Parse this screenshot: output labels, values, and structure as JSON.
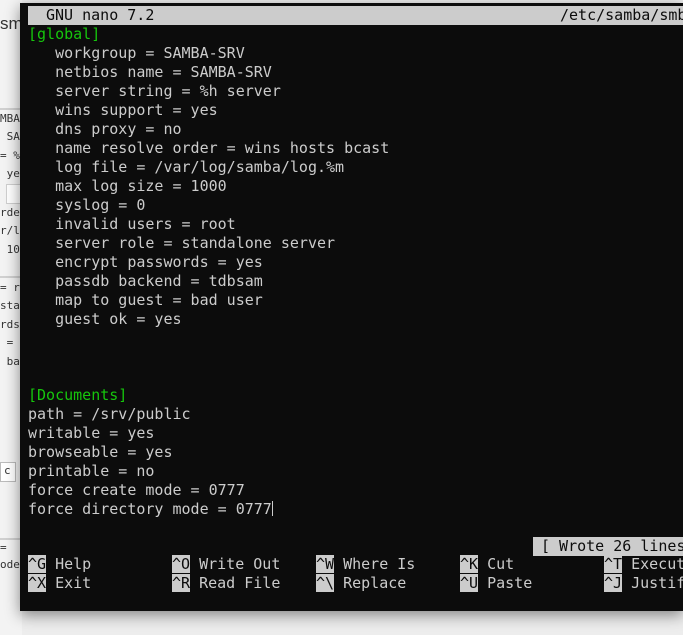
{
  "background": {
    "title_fragment": "sm",
    "fragments": [
      "MBA",
      " SA",
      "= %",
      " ye",
      "rde",
      "r/l",
      " 10",
      "= r",
      "sta",
      "rds",
      " =",
      " ba",
      "c",
      "=",
      "ode"
    ]
  },
  "nano": {
    "app_title": "GNU nano 7.2",
    "file_path": "/etc/samba/smb",
    "lines": [
      "[global]",
      "   workgroup = SAMBA-SRV",
      "   netbios name = SAMBA-SRV",
      "   server string = %h server",
      "   wins support = yes",
      "   dns proxy = no",
      "   name resolve order = wins hosts bcast",
      "   log file = /var/log/samba/log.%m",
      "   max log size = 1000",
      "   syslog = 0",
      "   invalid users = root",
      "   server role = standalone server",
      "   encrypt passwords = yes",
      "   passdb backend = tdbsam",
      "   map to guest = bad user",
      "   guest ok = yes",
      "",
      "",
      "",
      "[Documents]",
      "path = /srv/public",
      "writable = yes",
      "browseable = yes",
      "printable = no",
      "force create mode = 0777",
      "force directory mode = 0777"
    ],
    "status_message": "[ Wrote 26 lines",
    "shortcuts": {
      "help": {
        "key": "^G",
        "label": "Help"
      },
      "write_out": {
        "key": "^O",
        "label": "Write Out"
      },
      "where_is": {
        "key": "^W",
        "label": "Where Is"
      },
      "cut": {
        "key": "^K",
        "label": "Cut"
      },
      "execute": {
        "key": "^T",
        "label": "Execut"
      },
      "exit": {
        "key": "^X",
        "label": "Exit"
      },
      "read_file": {
        "key": "^R",
        "label": "Read File"
      },
      "replace": {
        "key": "^\\",
        "label": "Replace"
      },
      "paste": {
        "key": "^U",
        "label": "Paste"
      },
      "justify": {
        "key": "^J",
        "label": "Justif"
      }
    }
  },
  "colors": {
    "terminal_bg": "#0c0c0c",
    "terminal_fg": "#cccccc",
    "section_header": "#16c60c"
  }
}
